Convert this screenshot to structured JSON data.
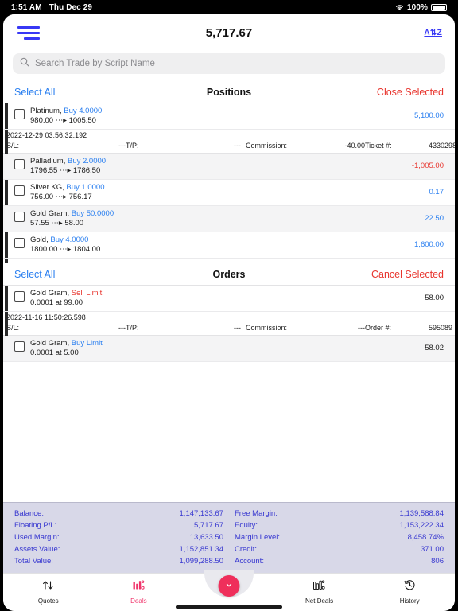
{
  "status_bar": {
    "time": "1:51 AM",
    "date": "Thu Dec 29",
    "battery_percent": "100%",
    "wifi_icon": "wifi-icon",
    "battery_icon": "battery-icon"
  },
  "topnav": {
    "menu_icon": "hamburger-menu-icon",
    "title": "5,717.67",
    "sort_label": "A⇅Z"
  },
  "search": {
    "placeholder": "Search Trade by Script Name",
    "value": "",
    "icon": "search-icon"
  },
  "positions_section": {
    "select_all_label": "Select All",
    "title": "Positions",
    "action_label": "Close Selected",
    "rows": [
      {
        "symbol": "Platinum,",
        "side": "Buy 4.0000",
        "side_type": "buy",
        "prices": "980.00 ⋯▸ 1005.50",
        "pl": "5,100.00",
        "pl_type": "pos",
        "alt": false,
        "expanded": true,
        "timestamp": "2022-12-29 03:56:32.192",
        "detail": {
          "sl_label": "S/L:",
          "sl_value": "---",
          "tp_label": "T/P:",
          "tp_value": "---",
          "commission_label": "Commission:",
          "commission_value": "-40.00",
          "ticket_label": "Ticket #:",
          "ticket_value": "4330298"
        }
      },
      {
        "symbol": "Palladium,",
        "side": "Buy 2.0000",
        "side_type": "buy",
        "prices": "1796.55 ⋯▸ 1786.50",
        "pl": "-1,005.00",
        "pl_type": "neg",
        "alt": true,
        "expanded": false
      },
      {
        "symbol": "Silver KG,",
        "side": "Buy 1.0000",
        "side_type": "buy",
        "prices": "756.00 ⋯▸ 756.17",
        "pl": "0.17",
        "pl_type": "pos",
        "alt": false,
        "expanded": false
      },
      {
        "symbol": "Gold Gram,",
        "side": "Buy 50.0000",
        "side_type": "buy",
        "prices": "57.55 ⋯▸ 58.00",
        "pl": "22.50",
        "pl_type": "pos",
        "alt": true,
        "expanded": false
      },
      {
        "symbol": "Gold,",
        "side": "Buy 4.0000",
        "side_type": "buy",
        "prices": "1800.00 ⋯▸ 1804.00",
        "pl": "1,600.00",
        "pl_type": "pos",
        "alt": false,
        "expanded": false
      }
    ]
  },
  "orders_section": {
    "select_all_label": "Select All",
    "title": "Orders",
    "action_label": "Cancel Selected",
    "rows": [
      {
        "symbol": "Gold Gram,",
        "side": "Sell Limit",
        "side_type": "sell",
        "prices": "0.0001 at 99.00",
        "pl": "58.00",
        "pl_type": "neu",
        "alt": false,
        "expanded": true,
        "timestamp": "2022-11-16 11:50:26.598",
        "detail": {
          "sl_label": "S/L:",
          "sl_value": "---",
          "tp_label": "T/P:",
          "tp_value": "---",
          "commission_label": "Commission:",
          "commission_value": "---",
          "ticket_label": "Order #:",
          "ticket_value": "595089"
        }
      },
      {
        "symbol": "Gold Gram,",
        "side": "Buy Limit",
        "side_type": "buy",
        "prices": "0.0001 at 5.00",
        "pl": "58.02",
        "pl_type": "neu",
        "alt": true,
        "expanded": false
      }
    ]
  },
  "summary": {
    "left": [
      {
        "label": "Balance:",
        "value": "1,147,133.67"
      },
      {
        "label": "Floating P/L:",
        "value": "5,717.67"
      },
      {
        "label": "Used Margin:",
        "value": "13,633.50"
      },
      {
        "label": "Assets Value:",
        "value": "1,152,851.34"
      },
      {
        "label": "Total Value:",
        "value": "1,099,288.50"
      }
    ],
    "right": [
      {
        "label": "Free Margin:",
        "value": "1,139,588.84"
      },
      {
        "label": "Equity:",
        "value": "1,153,222.34"
      },
      {
        "label": "Margin Level:",
        "value": "8,458.74%"
      },
      {
        "label": "Credit:",
        "value": "371.00"
      },
      {
        "label": "Account:",
        "value": "806"
      }
    ]
  },
  "tabbar": {
    "tabs": [
      {
        "label": "Quotes",
        "icon": "arrows-up-down-icon",
        "active": false
      },
      {
        "label": "Deals",
        "icon": "bar-chart-icon",
        "active": true
      },
      {
        "label": "Net Deals",
        "icon": "bar-chart-net-icon",
        "active": false
      },
      {
        "label": "History",
        "icon": "clock-rewind-icon",
        "active": false
      }
    ],
    "fab_icon": "chevron-down-icon"
  },
  "colors": {
    "accent_blue": "#2a7ff0",
    "brand_blue": "#3838f5",
    "danger_red": "#e8352e",
    "tab_active": "#f0336a",
    "fab": "#ef2f5b",
    "summary_bg": "#d8d8e8",
    "summary_text": "#3838d0"
  }
}
